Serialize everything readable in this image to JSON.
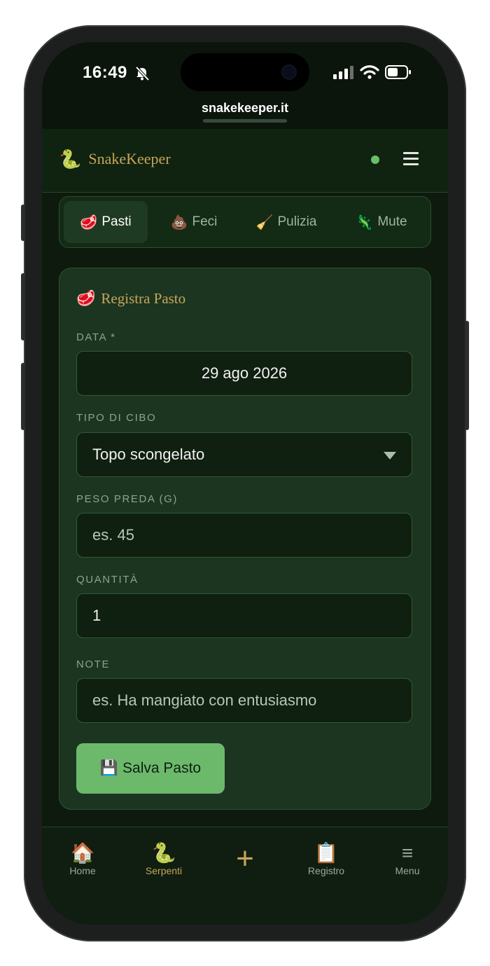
{
  "status_bar": {
    "time": "16:49"
  },
  "browser": {
    "url": "snakekeeper.it"
  },
  "app_header": {
    "brand_icon": "🐍",
    "brand_name": "SnakeKeeper"
  },
  "tabs": [
    {
      "emoji": "🥩",
      "label": "Pasti",
      "active": true
    },
    {
      "emoji": "💩",
      "label": "Feci",
      "active": false
    },
    {
      "emoji": "🧹",
      "label": "Pulizia",
      "active": false
    },
    {
      "emoji": "🦎",
      "label": "Mute",
      "active": false
    }
  ],
  "form": {
    "title_icon": "🥩",
    "title": "Registra Pasto",
    "date_label": "DATA *",
    "date_value": "29 ago 2026",
    "food_type_label": "TIPO DI CIBO",
    "food_type_value": "Topo scongelato",
    "prey_weight_label": "PESO PREDA (G)",
    "prey_weight_placeholder": "es. 45",
    "quantity_label": "QUANTITÀ",
    "quantity_value": "1",
    "notes_label": "NOTE",
    "notes_placeholder": "es. Ha mangiato con entusiasmo",
    "save_icon": "💾",
    "save_label": "Salva Pasto"
  },
  "bottom_nav": {
    "home_icon": "🏠",
    "home_label": "Home",
    "snakes_icon": "🐍",
    "snakes_label": "Serpenti",
    "add_icon": "+",
    "log_icon": "📋",
    "log_label": "Registro",
    "menu_icon": "≡",
    "menu_label": "Menu"
  },
  "colors": {
    "accent_gold": "#c8a55a",
    "primary_green": "#6cb96c",
    "online_dot": "#6bbf6b"
  }
}
